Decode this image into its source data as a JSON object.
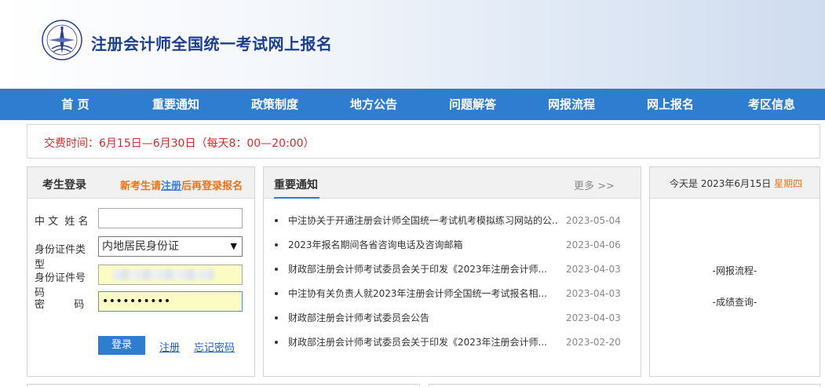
{
  "header": {
    "site_title": "注册会计师全国统一考试网上报名",
    "logo_icon": "cicpa-emblem-icon"
  },
  "nav": {
    "items": [
      {
        "label": "首 页"
      },
      {
        "label": "重要通知"
      },
      {
        "label": "政策制度"
      },
      {
        "label": "地方公告"
      },
      {
        "label": "问题解答"
      },
      {
        "label": "网报流程"
      },
      {
        "label": "网上报名"
      },
      {
        "label": "考区信息"
      }
    ]
  },
  "fee": {
    "text": "交费时间：6月15日—6月30日（每天8：00—20:00）"
  },
  "login": {
    "title": "考生登录",
    "tip_prefix": "新考生请",
    "tip_link": "注册",
    "tip_suffix": "后再登录报名",
    "name_label": "中 文  姓 名",
    "name_value": "",
    "idtype_label": "身份证件类型",
    "idtype_value": "内地居民身份证",
    "idnum_label": "身份证件号码",
    "password_label": "密         码",
    "password_dots": "••••••••••",
    "login_button": "登录",
    "register_link": "注册",
    "forgot_link": "忘记密码"
  },
  "notice": {
    "title": "重要通知",
    "more": "更多 >>",
    "items": [
      {
        "text": "中注协关于开通注册会计师全国统一考试机考模拟练习网站的公...",
        "date": "2023-05-04"
      },
      {
        "text": "2023年报名期间各省咨询电话及咨询邮箱",
        "date": "2023-04-06"
      },
      {
        "text": "财政部注册会计师考试委员会关于印发《2023年注册会计师...",
        "date": "2023-04-03"
      },
      {
        "text": "中注协有关负责人就2023年注册会计师全国统一考试报名相...",
        "date": "2023-04-03"
      },
      {
        "text": "财政部注册会计师考试委员会公告",
        "date": "2023-04-03"
      },
      {
        "text": "财政部注册会计师考试委员会关于印发《2023年注册会计师...",
        "date": "2023-02-20"
      }
    ]
  },
  "side": {
    "date_prefix": "今天是 2023年6月15日 ",
    "weekday": "星期四",
    "link1": "-网报流程-",
    "link2": "-成绩查询-"
  },
  "colors": {
    "nav_bg": "#2f7dd1",
    "title_blue": "#1d3f8f",
    "fee_red": "#d92b2b",
    "accent_orange": "#e8741c"
  }
}
